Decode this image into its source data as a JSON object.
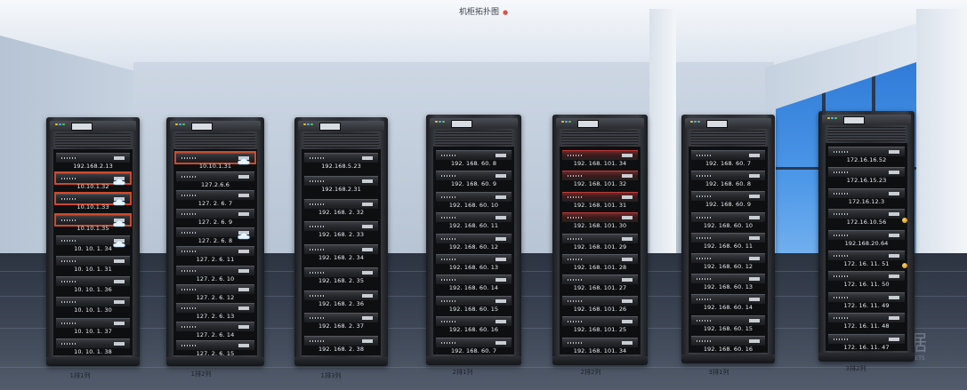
{
  "title": "机柜拓扑图",
  "watermark": {
    "glyph": "据",
    "sub": "SYSTEMNETS"
  },
  "racks": [
    {
      "label": "1排1列",
      "servers": [
        {
          "ip": "192.168.2.13",
          "sel": false,
          "cloud": false
        },
        {
          "ip": "10.10.1.32",
          "sel": true,
          "cloud": true
        },
        {
          "ip": "10.10.1.33",
          "sel": true,
          "cloud": true
        },
        {
          "ip": "10.10.1.35",
          "sel": true,
          "cloud": true
        },
        {
          "ip": "10. 10. 1. 34",
          "sel": false,
          "cloud": true
        },
        {
          "ip": "10. 10. 1. 31",
          "sel": false,
          "cloud": false
        },
        {
          "ip": "10. 10. 1. 36",
          "sel": false,
          "cloud": false
        },
        {
          "ip": "10. 10. 1. 30",
          "sel": false,
          "cloud": false
        },
        {
          "ip": "10. 10. 1. 37",
          "sel": false,
          "cloud": false
        },
        {
          "ip": "10. 10. 1. 38",
          "sel": false,
          "cloud": false
        }
      ]
    },
    {
      "label": "1排2列",
      "servers": [
        {
          "ip": "10.10.1.31",
          "sel": true,
          "cloud": true
        },
        {
          "ip": "127.2.6.6",
          "sel": false,
          "cloud": false
        },
        {
          "ip": "127. 2. 6. 7",
          "sel": false,
          "cloud": false
        },
        {
          "ip": "127. 2. 6. 9",
          "sel": false,
          "cloud": false
        },
        {
          "ip": "127. 2. 6. 8",
          "sel": false,
          "cloud": true
        },
        {
          "ip": "127. 2. 6. 11",
          "sel": false,
          "cloud": false
        },
        {
          "ip": "127. 2. 6. 10",
          "sel": false,
          "cloud": false
        },
        {
          "ip": "127. 2. 6. 12",
          "sel": false,
          "cloud": false
        },
        {
          "ip": "127. 2. 6. 13",
          "sel": false,
          "cloud": false
        },
        {
          "ip": "127. 2. 6. 14",
          "sel": false,
          "cloud": false
        },
        {
          "ip": "127. 2. 6. 15",
          "sel": false,
          "cloud": false
        }
      ]
    },
    {
      "label": "1排3列",
      "servers": [
        {
          "ip": "192.168.5.23",
          "sel": false,
          "cloud": false
        },
        {
          "ip": "192.168.2.31",
          "sel": false,
          "cloud": false
        },
        {
          "ip": "192. 168. 2. 32",
          "sel": false,
          "cloud": false
        },
        {
          "ip": "192. 168. 2. 33",
          "sel": false,
          "cloud": false
        },
        {
          "ip": "192. 168. 2. 34",
          "sel": false,
          "cloud": false
        },
        {
          "ip": "192. 168. 2. 35",
          "sel": false,
          "cloud": false
        },
        {
          "ip": "192. 168. 2. 36",
          "sel": false,
          "cloud": false
        },
        {
          "ip": "192. 168. 2. 37",
          "sel": false,
          "cloud": false
        },
        {
          "ip": "192. 168. 2. 38",
          "sel": false,
          "cloud": false
        }
      ]
    },
    {
      "label": "2排1列",
      "servers": [
        {
          "ip": "192. 168. 60. 8",
          "sel": false,
          "cloud": false
        },
        {
          "ip": "192. 168. 60. 9",
          "sel": false,
          "cloud": false
        },
        {
          "ip": "192. 168. 60. 10",
          "sel": false,
          "cloud": false
        },
        {
          "ip": "192. 168. 60. 11",
          "sel": false,
          "cloud": false
        },
        {
          "ip": "192. 168. 60. 12",
          "sel": false,
          "cloud": false
        },
        {
          "ip": "192. 168. 60. 13",
          "sel": false,
          "cloud": false
        },
        {
          "ip": "192. 168. 60. 14",
          "sel": false,
          "cloud": false
        },
        {
          "ip": "192. 168. 60. 15",
          "sel": false,
          "cloud": false
        },
        {
          "ip": "192. 168. 60. 16",
          "sel": false,
          "cloud": false
        },
        {
          "ip": "192. 168. 60. 7",
          "sel": false,
          "cloud": false
        }
      ]
    },
    {
      "label": "2排2列",
      "servers": [
        {
          "ip": "192. 168. 101. 34",
          "sel": false,
          "cloud": false,
          "red": true
        },
        {
          "ip": "192. 168. 101. 32",
          "sel": false,
          "cloud": false,
          "red": true
        },
        {
          "ip": "192. 168. 101. 31",
          "sel": false,
          "cloud": false,
          "red": true
        },
        {
          "ip": "192. 168. 101. 30",
          "sel": false,
          "cloud": false,
          "red": true
        },
        {
          "ip": "192. 168. 101. 29",
          "sel": false,
          "cloud": false
        },
        {
          "ip": "192. 168. 101. 28",
          "sel": false,
          "cloud": false
        },
        {
          "ip": "192. 168. 101. 27",
          "sel": false,
          "cloud": false
        },
        {
          "ip": "192. 168. 101. 26",
          "sel": false,
          "cloud": false
        },
        {
          "ip": "192. 168. 101. 25",
          "sel": false,
          "cloud": false
        },
        {
          "ip": "192. 168. 101. 34",
          "sel": false,
          "cloud": false
        }
      ]
    },
    {
      "label": "3排1列",
      "servers": [
        {
          "ip": "192. 168. 60. 7",
          "sel": false,
          "cloud": false
        },
        {
          "ip": "192. 168. 60. 8",
          "sel": false,
          "cloud": false
        },
        {
          "ip": "192. 168. 60. 9",
          "sel": false,
          "cloud": false
        },
        {
          "ip": "192. 168. 60. 10",
          "sel": false,
          "cloud": false
        },
        {
          "ip": "192. 168. 60. 11",
          "sel": false,
          "cloud": false
        },
        {
          "ip": "192. 168. 60. 12",
          "sel": false,
          "cloud": false
        },
        {
          "ip": "192. 168. 60. 13",
          "sel": false,
          "cloud": false
        },
        {
          "ip": "192. 168. 60. 14",
          "sel": false,
          "cloud": false
        },
        {
          "ip": "192. 168. 60. 15",
          "sel": false,
          "cloud": false
        },
        {
          "ip": "192. 168. 60. 16",
          "sel": false,
          "cloud": false
        }
      ]
    },
    {
      "label": "3排2列",
      "servers": [
        {
          "ip": "172.16.16.52",
          "sel": false,
          "cloud": false
        },
        {
          "ip": "172.16.15.23",
          "sel": false,
          "cloud": false
        },
        {
          "ip": "172.16.12.3",
          "sel": false,
          "cloud": false
        },
        {
          "ip": "172.16.10.56",
          "sel": false,
          "cloud": false
        },
        {
          "ip": "192.168.20.64",
          "sel": false,
          "cloud": false
        },
        {
          "ip": "172. 16. 11. 51",
          "sel": false,
          "cloud": false
        },
        {
          "ip": "172. 16. 11. 50",
          "sel": false,
          "cloud": false
        },
        {
          "ip": "172. 16. 11. 49",
          "sel": false,
          "cloud": false
        },
        {
          "ip": "172. 16. 11. 48",
          "sel": false,
          "cloud": false
        },
        {
          "ip": "172. 16. 11. 47",
          "sel": false,
          "cloud": false
        }
      ]
    }
  ]
}
